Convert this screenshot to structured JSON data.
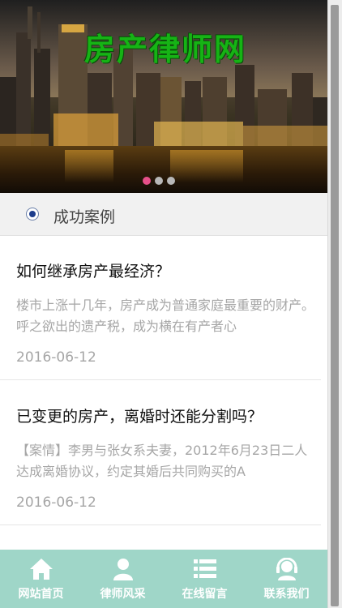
{
  "banner": {
    "title": "房产律师网",
    "slide_count": 3,
    "active_slide": 1
  },
  "section": {
    "title": "成功案例"
  },
  "articles": [
    {
      "title": "如何继承房产最经济？",
      "summary": "楼市上涨十几年，房产成为普通家庭最重要的财产。呼之欲出的遗产税，成为横在有产者心",
      "date": "2016-06-12"
    },
    {
      "title": "已变更的房产，离婚时还能分割吗？",
      "summary": "【案情】李男与张女系夫妻，2012年6月23日二人达成离婚协议，约定其婚后共同购买的A",
      "date": "2016-06-12"
    }
  ],
  "footer": {
    "items": [
      {
        "label": "网站首页",
        "icon": "home-icon"
      },
      {
        "label": "律师风采",
        "icon": "user-icon"
      },
      {
        "label": "在线留言",
        "icon": "list-icon"
      },
      {
        "label": "联系我们",
        "icon": "headset-icon"
      }
    ]
  },
  "colors": {
    "footer_bg": "#9fd6c8",
    "title_green": "#16b315",
    "dot_active": "#e6508a"
  }
}
